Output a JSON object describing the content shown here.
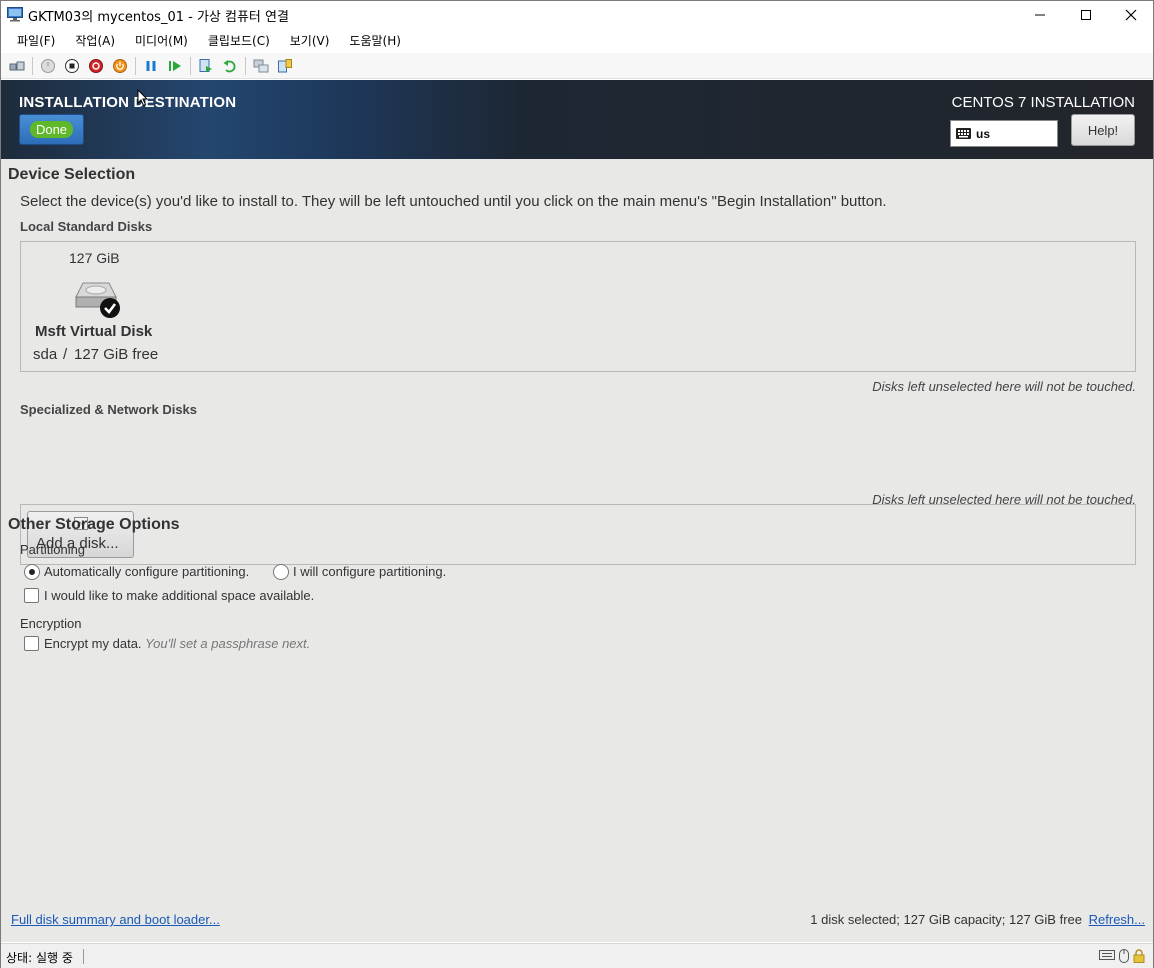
{
  "window": {
    "title": "GKTM03의 mycentos_01 - 가상 컴퓨터 연결",
    "minimize": "—",
    "maximize": "☐",
    "close": "✕"
  },
  "menu": [
    "파일(F)",
    "작업(A)",
    "미디어(M)",
    "클립보드(C)",
    "보기(V)",
    "도움말(H)"
  ],
  "toolbar": [
    "ctrl-alt-del-icon",
    "start-icon",
    "turn-off-icon",
    "shutdown-icon",
    "save-icon",
    "pause-icon",
    "reset-icon",
    "checkpoint-icon",
    "revert-icon",
    "enhanced-session-icon",
    "share-icon"
  ],
  "header": {
    "title": "INSTALLATION DESTINATION",
    "done_label": "Done",
    "product_title": "CENTOS 7 INSTALLATION",
    "keyboard_layout": "us",
    "help_label": "Help!"
  },
  "device_selection": {
    "title": "Device Selection",
    "description": "Select the device(s) you'd like to install to.  They will be left untouched until you click on the main menu's \"Begin Installation\" button.",
    "local_title": "Local Standard Disks",
    "disk": {
      "size": "127 GiB",
      "name": "Msft Virtual Disk",
      "device": "sda",
      "separator": "/",
      "free": "127 GiB free"
    },
    "local_note": "Disks left unselected here will not be touched.",
    "network_title": "Specialized & Network Disks",
    "add_disk_label": "Add a disk...",
    "network_note": "Disks left unselected here will not be touched."
  },
  "other_storage": {
    "title": "Other Storage Options",
    "partitioning_title": "Partitioning",
    "auto_label": "Automatically configure partitioning.",
    "auto_selected": true,
    "manual_label": "I will configure partitioning.",
    "additional_space_label": "I would like to make additional space available.",
    "encryption_title": "Encryption",
    "encrypt_label": "Encrypt my data.",
    "encrypt_hint": "You'll set a passphrase next."
  },
  "footer": {
    "summary_link": "Full disk summary and boot loader...",
    "summary": "1 disk selected; 127 GiB capacity; 127 GiB free",
    "refresh_link": "Refresh..."
  },
  "status": {
    "text": "상태: 실행 중"
  }
}
